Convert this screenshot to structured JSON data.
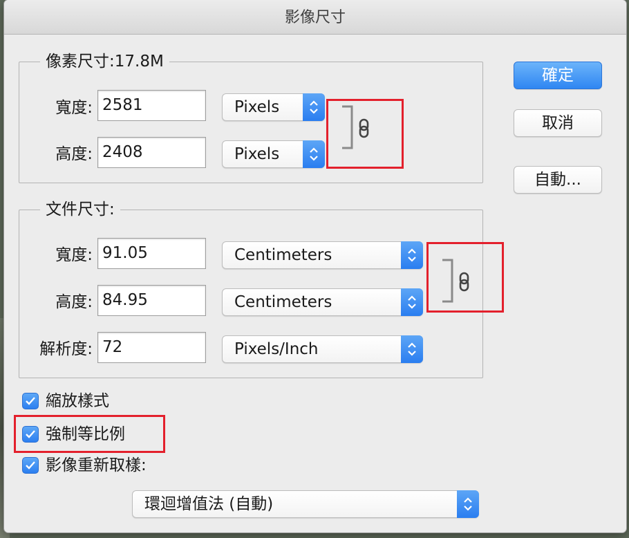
{
  "dialog": {
    "title": "影像尺寸",
    "ok_label": "確定",
    "cancel_label": "取消",
    "auto_label": "自動..."
  },
  "pixel_dimensions": {
    "legend": "像素尺寸:17.8M",
    "width_label": "寬度:",
    "width_value": "2581",
    "width_unit": "Pixels",
    "height_label": "高度:",
    "height_value": "2408",
    "height_unit": "Pixels"
  },
  "document_size": {
    "legend": "文件尺寸:",
    "width_label": "寬度:",
    "width_value": "91.05",
    "width_unit": "Centimeters",
    "height_label": "高度:",
    "height_value": "84.95",
    "height_unit": "Centimeters",
    "resolution_label": "解析度:",
    "resolution_value": "72",
    "resolution_unit": "Pixels/Inch"
  },
  "options": {
    "scale_styles": {
      "label": "縮放樣式",
      "checked": true
    },
    "constrain_proportions": {
      "label": "強制等比例",
      "checked": true
    },
    "resample_image": {
      "label": "影像重新取樣:",
      "checked": true
    },
    "resample_method": "環迴增值法 (自動)"
  },
  "icons": {
    "link_pixel": "chain-link-icon",
    "link_document": "chain-link-icon",
    "stepper": "up-down-chevron-icon",
    "checkmark": "checkmark-icon"
  },
  "colors": {
    "accent_blue": "#2f86f2",
    "highlight_red": "#e3202c",
    "dialog_bg": "#ececec"
  }
}
